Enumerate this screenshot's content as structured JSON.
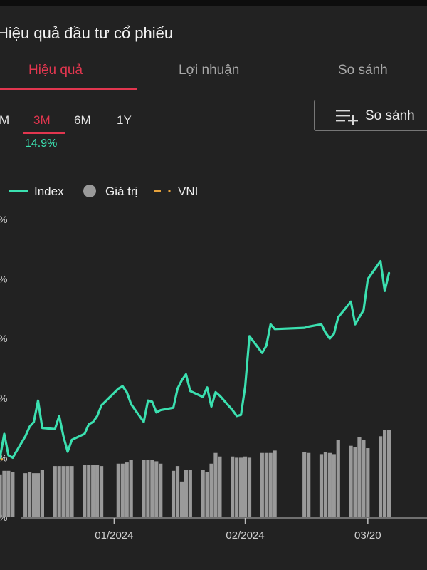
{
  "title": "Hiệu quả đầu tư cổ phiếu",
  "tabs": [
    {
      "label": "Hiệu quả",
      "active": true
    },
    {
      "label": "Lợi nhuận",
      "active": false
    },
    {
      "label": "So sánh",
      "active": false
    }
  ],
  "periods": [
    {
      "label": "M",
      "active": false
    },
    {
      "label": "3M",
      "active": true
    },
    {
      "label": "6M",
      "active": false
    },
    {
      "label": "1Y",
      "active": false
    }
  ],
  "period_return": "14.9%",
  "compare_button": {
    "label": "So sánh",
    "icon": "add-list-icon"
  },
  "colors": {
    "accent": "#e2364f",
    "index": "#3be0b0",
    "vni": "#e6a23c",
    "bars": "#9a9a9a"
  },
  "chart_data": {
    "type": "line",
    "legend": [
      {
        "name": "Index",
        "style": "line",
        "color": "#3be0b0"
      },
      {
        "name": "Giá trị",
        "style": "circle",
        "color": "#9a9a9a"
      },
      {
        "name": "VNI",
        "style": "dashed",
        "color": "#e6a23c"
      }
    ],
    "xlim": [
      "2023-12-05",
      "2024-03-15"
    ],
    "ylim": [
      0,
      25
    ],
    "y_tick_labels": [
      "%",
      "%",
      "%",
      "%",
      "%",
      "%"
    ],
    "x_ticks": [
      {
        "date": "2024-01-01",
        "label": "01/2024"
      },
      {
        "date": "2024-02-01",
        "label": "02/2024"
      },
      {
        "date": "2024-03-01",
        "label": "03/20"
      }
    ],
    "series": [
      {
        "name": "Index",
        "x": [
          "2023-12-05",
          "2023-12-06",
          "2023-12-07",
          "2023-12-08",
          "2023-12-11",
          "2023-12-12",
          "2023-12-13",
          "2023-12-14",
          "2023-12-15",
          "2023-12-18",
          "2023-12-19",
          "2023-12-20",
          "2023-12-21",
          "2023-12-22",
          "2023-12-25",
          "2023-12-26",
          "2023-12-27",
          "2023-12-28",
          "2023-12-29",
          "2024-01-02",
          "2024-01-03",
          "2024-01-04",
          "2024-01-05",
          "2024-01-08",
          "2024-01-09",
          "2024-01-10",
          "2024-01-11",
          "2024-01-12",
          "2024-01-15",
          "2024-01-16",
          "2024-01-17",
          "2024-01-18",
          "2024-01-19",
          "2024-01-22",
          "2024-01-23",
          "2024-01-24",
          "2024-01-25",
          "2024-01-26",
          "2024-01-29",
          "2024-01-30",
          "2024-01-31",
          "2024-02-01",
          "2024-02-02",
          "2024-02-05",
          "2024-02-06",
          "2024-02-07",
          "2024-02-08",
          "2024-02-15",
          "2024-02-16",
          "2024-02-19",
          "2024-02-20",
          "2024-02-21",
          "2024-02-22",
          "2024-02-23",
          "2024-02-26",
          "2024-02-27",
          "2024-02-28",
          "2024-02-29",
          "2024-03-01",
          "2024-03-04",
          "2024-03-05",
          "2024-03-06"
        ],
        "values": [
          5.0,
          7.0,
          5.2,
          5.0,
          6.8,
          7.6,
          8.0,
          9.8,
          7.5,
          7.4,
          8.5,
          6.8,
          5.5,
          6.5,
          7.0,
          7.8,
          8.0,
          8.5,
          9.4,
          10.8,
          11.0,
          10.5,
          9.5,
          8.0,
          9.8,
          9.7,
          8.8,
          9.0,
          9.2,
          10.8,
          11.5,
          12.0,
          10.6,
          10.1,
          10.9,
          9.3,
          10.5,
          10.2,
          9.0,
          8.5,
          8.6,
          11.0,
          15.2,
          13.8,
          14.4,
          16.2,
          15.8,
          15.9,
          16.0,
          16.2,
          15.5,
          15.0,
          15.4,
          16.8,
          18.1,
          16.2,
          16.8,
          17.4,
          20.0,
          21.5,
          19.0,
          20.5
        ],
        "color": "#3be0b0"
      },
      {
        "name": "VNI",
        "x": [
          "2023-12-05",
          "2023-12-06"
        ],
        "values": [
          5.0,
          4.7
        ],
        "color": "#e6a23c"
      },
      {
        "name": "Giá trị",
        "x": [
          "2023-12-05",
          "2023-12-06",
          "2023-12-07",
          "2023-12-08",
          "2023-12-11",
          "2023-12-12",
          "2023-12-13",
          "2023-12-14",
          "2023-12-15",
          "2023-12-18",
          "2023-12-19",
          "2023-12-20",
          "2023-12-21",
          "2023-12-22",
          "2023-12-25",
          "2023-12-26",
          "2023-12-27",
          "2023-12-28",
          "2023-12-29",
          "2024-01-02",
          "2024-01-03",
          "2024-01-04",
          "2024-01-05",
          "2024-01-08",
          "2024-01-09",
          "2024-01-10",
          "2024-01-11",
          "2024-01-12",
          "2024-01-15",
          "2024-01-16",
          "2024-01-17",
          "2024-01-18",
          "2024-01-19",
          "2024-01-22",
          "2024-01-23",
          "2024-01-24",
          "2024-01-25",
          "2024-01-26",
          "2024-01-29",
          "2024-01-30",
          "2024-01-31",
          "2024-02-01",
          "2024-02-02",
          "2024-02-05",
          "2024-02-06",
          "2024-02-07",
          "2024-02-08",
          "2024-02-15",
          "2024-02-16",
          "2024-02-19",
          "2024-02-20",
          "2024-02-21",
          "2024-02-22",
          "2024-02-23",
          "2024-02-26",
          "2024-02-27",
          "2024-02-28",
          "2024-02-29",
          "2024-03-01",
          "2024-03-04",
          "2024-03-05",
          "2024-03-06"
        ],
        "values": [
          3.6,
          3.9,
          3.9,
          3.8,
          3.7,
          3.8,
          3.7,
          3.7,
          4.0,
          4.3,
          4.3,
          4.3,
          4.3,
          4.3,
          4.4,
          4.4,
          4.4,
          4.4,
          4.3,
          4.5,
          4.5,
          4.6,
          4.8,
          4.8,
          4.8,
          4.8,
          4.7,
          4.5,
          3.9,
          4.3,
          3.0,
          4.0,
          4.0,
          4.0,
          3.8,
          4.5,
          5.4,
          5.1,
          5.1,
          5.0,
          5.0,
          5.1,
          5.0,
          5.4,
          5.4,
          5.4,
          5.6,
          5.5,
          5.4,
          5.3,
          5.5,
          5.4,
          5.3,
          6.5,
          6.0,
          5.9,
          6.7,
          6.5,
          5.8,
          6.8,
          7.3,
          7.3
        ],
        "color": "#9a9a9a"
      }
    ]
  }
}
